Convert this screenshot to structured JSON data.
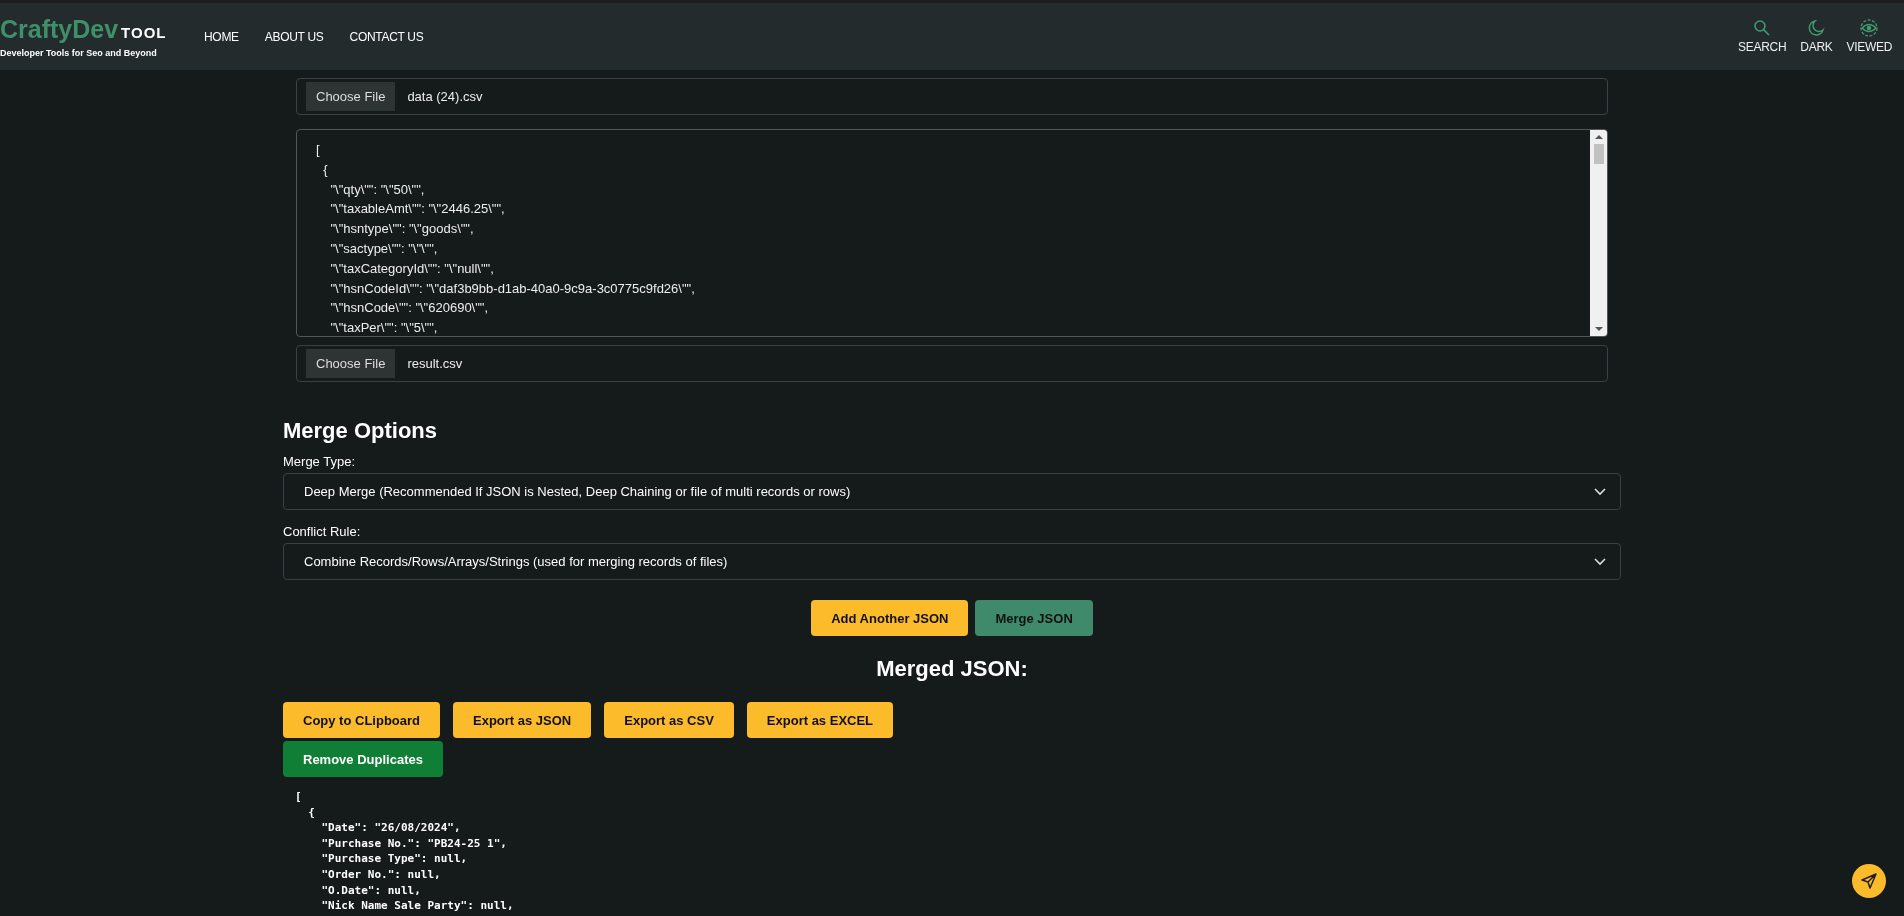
{
  "header": {
    "logo_main": "CraftyDev",
    "logo_suffix": "TOOL",
    "tagline": "Developer Tools for Seo and Beyond",
    "nav": [
      {
        "label": "HOME"
      },
      {
        "label": "ABOUT US"
      },
      {
        "label": "CONTACT US"
      }
    ],
    "actions": [
      {
        "kind": "search",
        "label": "SEARCH"
      },
      {
        "kind": "moon",
        "label": "DARK"
      },
      {
        "kind": "eye",
        "label": "VIEWED"
      }
    ]
  },
  "inputs": [
    {
      "button": "Choose File",
      "file": "data (24).csv",
      "lines": [
        "[",
        "  {",
        "    \"\\\"qty\\\"\": \"\\\"50\\\"\",",
        "    \"\\\"taxableAmt\\\"\": \"\\\"2446.25\\\"\",",
        "    \"\\\"hsntype\\\"\": \"\\\"goods\\\"\",",
        "    \"\\\"sactype\\\"\": \"\\\"\\\"\",",
        "    \"\\\"taxCategoryId\\\"\": \"\\\"null\\\"\",",
        "    \"\\\"hsnCodeId\\\"\": \"\\\"daf3b9bb-d1ab-40a0-9c9a-3c0775c9fd26\\\"\",",
        "    \"\\\"hsnCode\\\"\": \"\\\"620690\\\"\",",
        "    \"\\\"taxPer\\\"\": \"\\\"5\\\"\","
      ]
    },
    {
      "button": "Choose File",
      "file": "result.csv"
    }
  ],
  "merge_options": {
    "title": "Merge Options",
    "fields": [
      {
        "label": "Merge Type:",
        "value": "Deep Merge (Recommended If JSON is Nested, Deep Chaining or file of multi records or rows)"
      },
      {
        "label": "Conflict Rule:",
        "value": "Combine Records/Rows/Arrays/Strings (used for merging records of files)"
      }
    ]
  },
  "actions": [
    {
      "label": "Add Another JSON",
      "kind": "yellow"
    },
    {
      "label": "Merge JSON",
      "kind": "teal"
    }
  ],
  "result": {
    "title": "Merged JSON:",
    "buttons": [
      {
        "label": "Copy to CLipboard",
        "kind": "yellow"
      },
      {
        "label": "Export as JSON",
        "kind": "yellow"
      },
      {
        "label": "Export as CSV",
        "kind": "yellow"
      },
      {
        "label": "Export as EXCEL",
        "kind": "yellow"
      },
      {
        "label": "Remove Duplicates",
        "kind": "green"
      }
    ],
    "lines": [
      "[",
      "  {",
      "    \"Date\": \"26/08/2024\",",
      "    \"Purchase No.\": \"PB24-25 1\",",
      "    \"Purchase Type\": null,",
      "    \"Order No.\": null,",
      "    \"O.Date\": null,",
      "    \"Nick Name Sale Party\": null,"
    ]
  }
}
